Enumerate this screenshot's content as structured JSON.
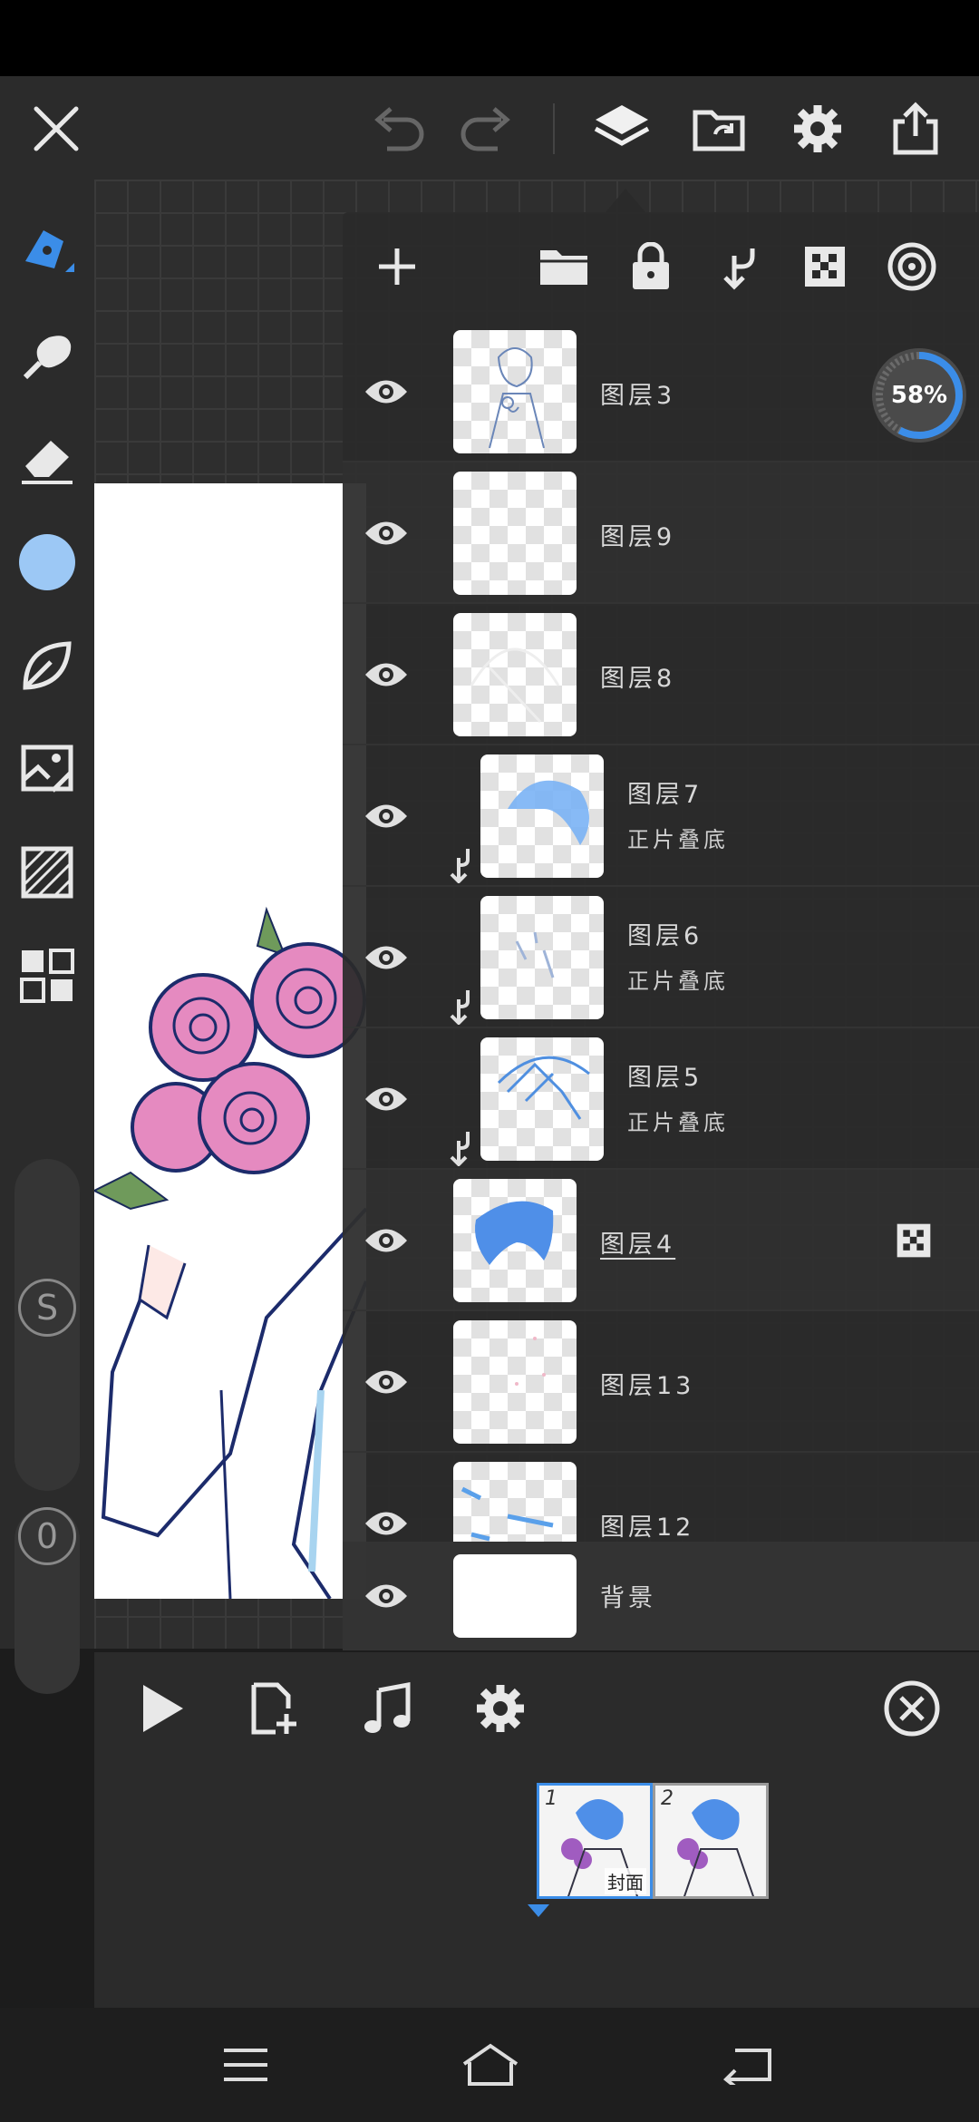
{
  "layers": [
    {
      "name": "图层3",
      "mode": "",
      "clipped": false,
      "thumb": "sketch"
    },
    {
      "name": "图层9",
      "mode": "",
      "clipped": false,
      "thumb": "empty"
    },
    {
      "name": "图层8",
      "mode": "",
      "clipped": false,
      "thumb": "faint"
    },
    {
      "name": "图层7",
      "mode": "正片叠底",
      "clipped": true,
      "thumb": "blue-hair"
    },
    {
      "name": "图层6",
      "mode": "正片叠底",
      "clipped": true,
      "thumb": "strokes"
    },
    {
      "name": "图层5",
      "mode": "正片叠底",
      "clipped": true,
      "thumb": "blue-lines"
    },
    {
      "name": "图层4",
      "mode": "",
      "clipped": false,
      "thumb": "blue-hair-solid"
    },
    {
      "name": "图层13",
      "mode": "",
      "clipped": false,
      "thumb": "dots"
    },
    {
      "name": "图层12",
      "mode": "",
      "clipped": false,
      "thumb": "blue-strokes"
    }
  ],
  "background_layer": {
    "name": "背景"
  },
  "progress": {
    "label": "58%",
    "percent": 58
  },
  "frames": [
    {
      "number": "1",
      "label": "封面"
    },
    {
      "number": "2",
      "label": ""
    }
  ],
  "colors": {
    "accent": "#3b8de8",
    "current_color": "#9cc8f5"
  },
  "slider_labels": {
    "size": "S",
    "opacity": "0"
  }
}
